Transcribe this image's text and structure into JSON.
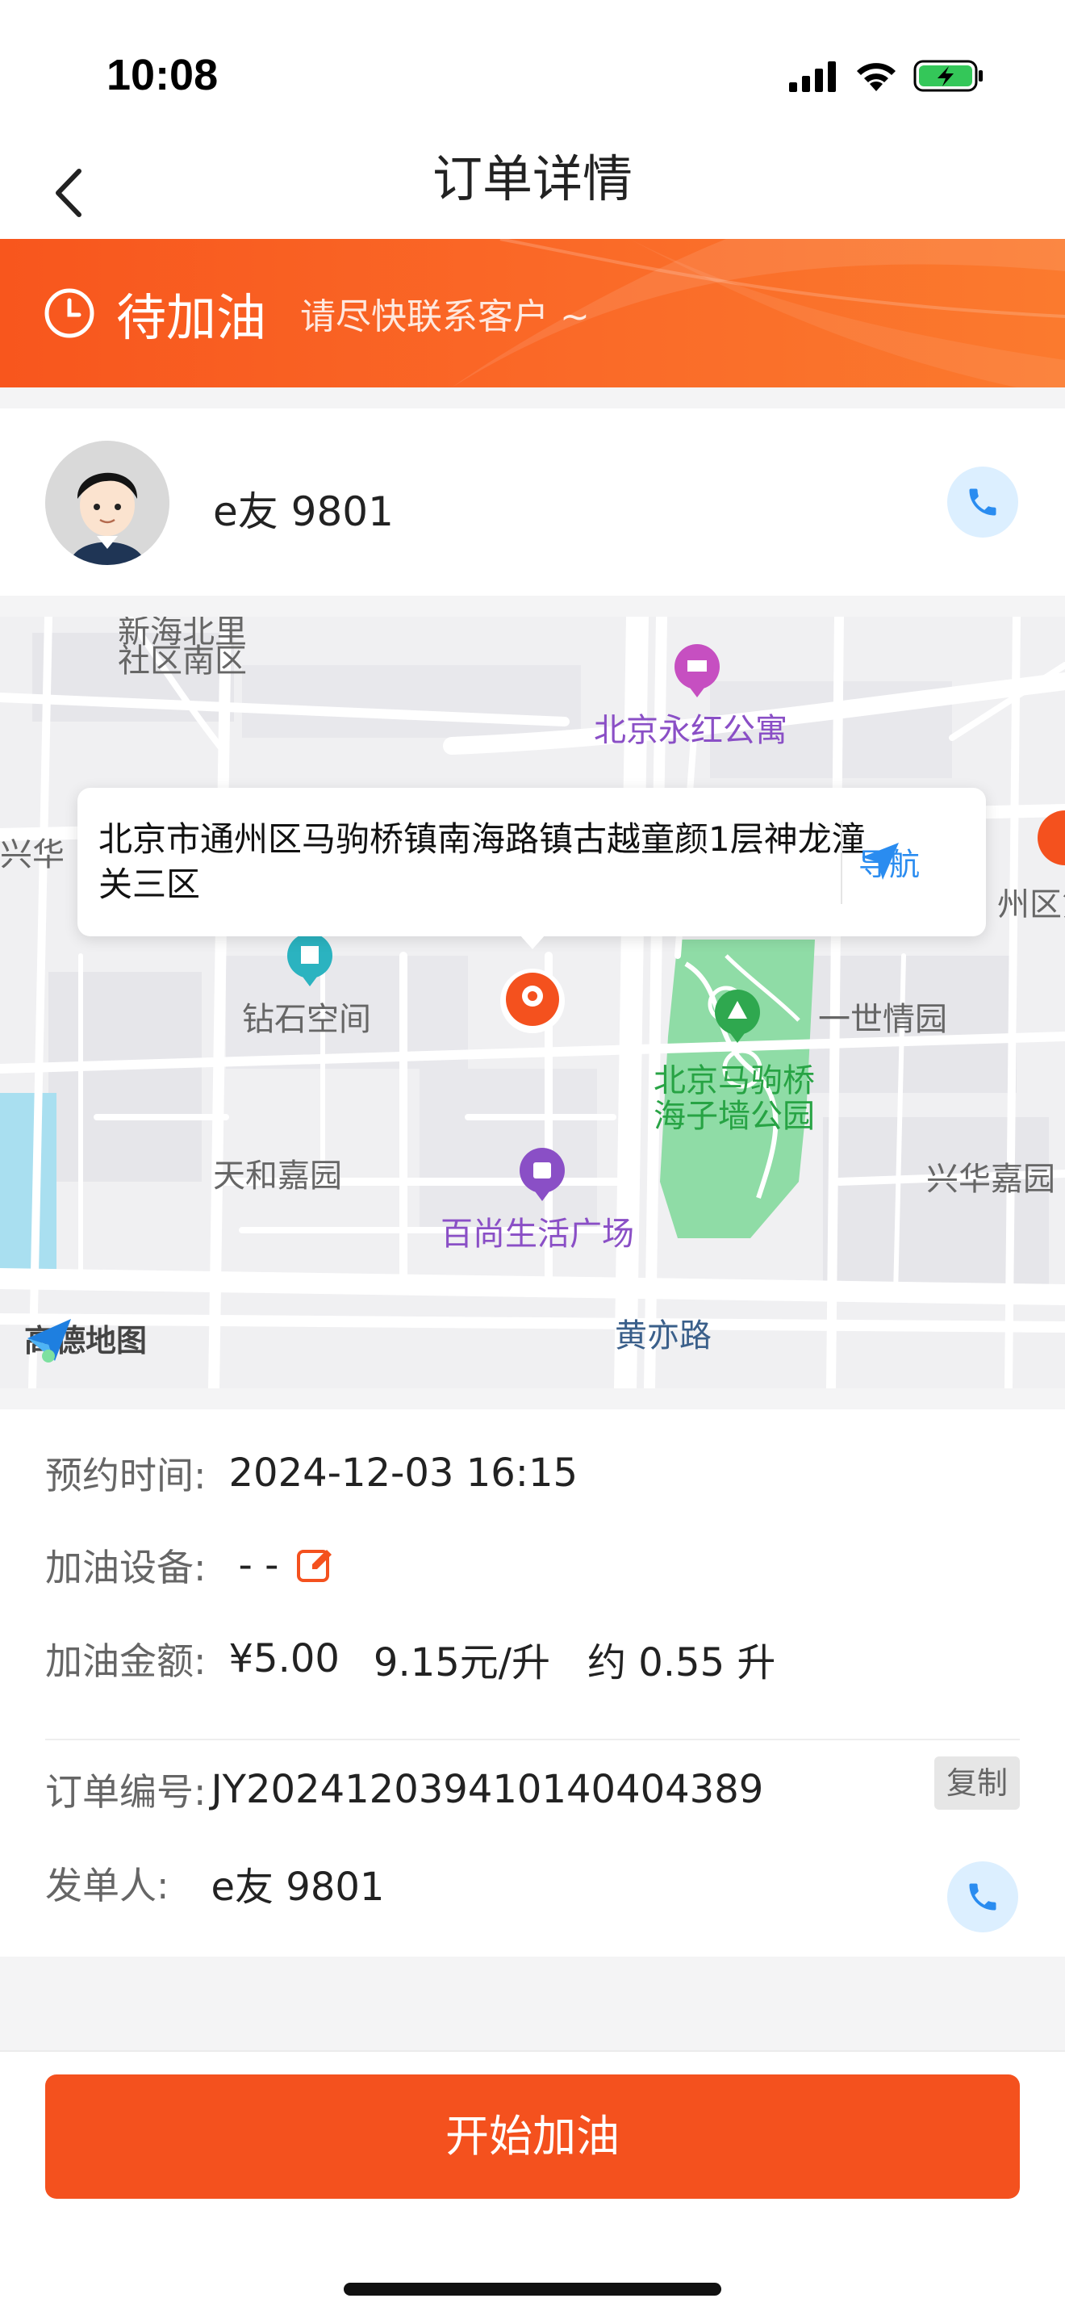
{
  "status_bar": {
    "time": "10:08"
  },
  "nav": {
    "title": "订单详情"
  },
  "banner": {
    "status": "待加油",
    "subtitle": "请尽快联系客户 ~"
  },
  "customer": {
    "name": "e友 9801"
  },
  "map": {
    "address": "北京市通州区马驹桥镇南海路镇古越童颜1层神龙潼关三区",
    "nav_label": "导航",
    "provider": "高德地图",
    "labels": {
      "community_top": "新海北里",
      "community_south": "社区南区",
      "apartment": "北京永红公寓",
      "xinghua_left": "兴华",
      "zhouqu_right": "州区第",
      "diamond_space": "钻石空间",
      "yishi_garden": "一世情园",
      "park_line1": "北京马驹桥",
      "park_line2": "海子墙公园",
      "tianhe_garden": "天和嘉园",
      "xinghua_right": "兴华嘉园",
      "plaza": "百尚生活广场",
      "road": "黄亦路"
    }
  },
  "details": {
    "appointment_label": "预约时间:",
    "appointment_value": "2024-12-03 16:15",
    "device_label": "加油设备:",
    "device_value": "- -",
    "amount_label": "加油金额:",
    "amount_value": "¥5.00",
    "price_value": "9.15元/升",
    "volume_value": "约 0.55 升",
    "order_label": "订单编号:",
    "order_value": "JY2024120394101404043 89",
    "copy_label": "复制",
    "sender_label": "发单人:",
    "sender_value": "e友 9801"
  },
  "action": {
    "start_label": "开始加油"
  },
  "colors": {
    "accent": "#f4511e",
    "link": "#2a8cf0",
    "call_bg": "#dcefff"
  }
}
